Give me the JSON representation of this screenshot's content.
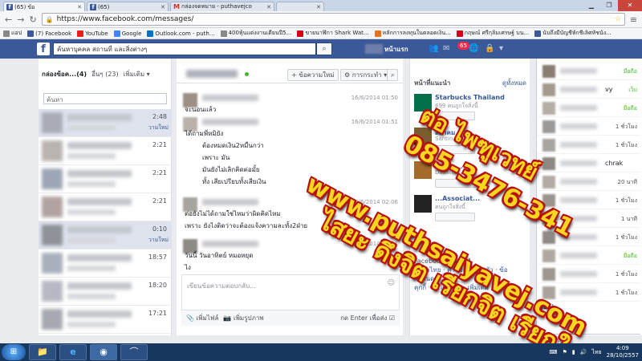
{
  "browser": {
    "tabs": [
      {
        "title": "(65)",
        "suffix": "ข้อ",
        "icon": "facebook-icon",
        "active": true
      },
      {
        "title": "(65)",
        "suffix": "",
        "icon": "facebook-icon",
        "active": false
      },
      {
        "title": "กล่องจดหมาย - puthavejco",
        "suffix": "",
        "icon": "gmail-icon",
        "active": false
      },
      {
        "title": "",
        "suffix": "",
        "icon": "blank-icon",
        "active": false
      }
    ],
    "url": "https://www.facebook.com/messages/",
    "bookmarks": [
      {
        "label": "แอป",
        "color": "#4a4a4a"
      },
      {
        "label": "(7) Facebook",
        "color": "#3b5998"
      },
      {
        "label": "YouTube",
        "color": "#e62117"
      },
      {
        "label": "Google",
        "color": "#4285f4"
      },
      {
        "label": "Outlook.com - puth...",
        "color": "#0072c6"
      },
      {
        "label": "400หุ้นแต่งงานเดียนปี5...",
        "color": "#888888"
      },
      {
        "label": "ขายนาฬิกา Shark Wat...",
        "color": "#d0021b"
      },
      {
        "label": "หลักการลงทุนในตลอดเงิน...",
        "color": "#e8711c"
      },
      {
        "label": "กฤษณ์ ศรีกุลิมเศรษฐ์ บน...",
        "color": "#d0021b"
      },
      {
        "label": "นับถึงมีบัญชีหักชีเลิศหัชนัง...",
        "color": "#3b5998"
      }
    ]
  },
  "fb": {
    "logo": "f",
    "search_placeholder": "ค้นหาบุคคล สถานที่ และสิ่งต่างๆ",
    "home": "หน้าแรก",
    "notification_count": "65",
    "accent": "#3b5998"
  },
  "inbox": {
    "tab_inbox": "กล่องข้อค...",
    "tab_inbox_count": "(4)",
    "tab_other": "อื่นๆ (23)",
    "more": "เพิ่มเติม",
    "search_placeholder": "ค้นหา",
    "conversations": [
      {
        "time": "2:48",
        "sub": "วามใหม่",
        "selected": true
      },
      {
        "time": "2:21",
        "sub": "",
        "selected": false
      },
      {
        "time": "2:21",
        "sub": "",
        "selected": false
      },
      {
        "time": "2:21",
        "sub": "",
        "selected": false
      },
      {
        "time": "0:10",
        "sub": "วามใหม่",
        "selected": true
      },
      {
        "time": "18:57",
        "sub": "",
        "selected": false
      },
      {
        "time": "18:20",
        "sub": "",
        "selected": false
      },
      {
        "time": "17:21",
        "sub": "",
        "selected": false
      }
    ]
  },
  "thread": {
    "new_message": "+ ข้อความใหม่",
    "actions": "การกระทำ",
    "messages": [
      {
        "time": "16/6/2014 01:50",
        "lines": [
          "จะนอนแล้ว"
        ]
      },
      {
        "time": "16/6/2014 01:51",
        "lines": [
          "ได้ถามพี่หมิยัง",
          "ต้องหมดเงิน2หมื่นกว่า",
          "เพราะ มัน",
          "มันยังไม่เลิกคิดต่อมั้ย",
          "ทั้ง เสียเปรียบทั้งเสียเงิน"
        ]
      },
      {
        "time": "16/6/2014 02:06",
        "lines": [
          "ต่อยังไม่ได้ถามใช่ไหมว่าผิดคิดไหม",
          "เพราะ ยังไงติดว่าจะต้องแจ้งความละทั้ง2ฝ่าย"
        ]
      },
      {
        "time": "16/6/2014 02:11",
        "lines": [
          "วันนี้ วันอาทิตย์ หมอหยุด",
          "ไง"
        ]
      }
    ],
    "composer_placeholder": "เขียนข้อความตอบกลับ...",
    "add_file": "เพิ่มไฟล์",
    "add_photo": "เพิ่มรูปภาพ",
    "enter_to_send": "กด Enter เพื่อส่ง"
  },
  "suggested": {
    "header": "หน้าที่แนะนำ",
    "see_all": "ดูทั้งหมด",
    "pages": [
      {
        "name": "Starbucks Thailand",
        "sub": "699 คนถูกใจสิ่งนี้",
        "color": "#00704a"
      },
      {
        "name": "สมาคม",
        "sub": "Santin...",
        "color": "#7a5c2e"
      },
      {
        "name": "สมาคม...",
        "sub": "Dinhin...",
        "color": "#a46a2b"
      },
      {
        "name": "...Associat...",
        "sub": "คนถูกใจสิ่งนี้",
        "color": "#222222"
      }
    ],
    "footer_copy": "Facebook © 2014",
    "footer_links": [
      "ภาษาไทย",
      "ความเป็นส่วนตัว",
      "ข้อกำหนด",
      "คุกกี้",
      "ลงโฆษณา",
      "เพิ่มเติม"
    ]
  },
  "chat": {
    "contacts": [
      {
        "status": "มือถือ",
        "online": true,
        "name": ""
      },
      {
        "status": "เว็บ",
        "online": true,
        "name": "vy"
      },
      {
        "status": "มือถือ",
        "online": true,
        "name": ""
      },
      {
        "status": "1 ชั่วโมง",
        "online": false,
        "name": ""
      },
      {
        "status": "1 ชั่วโมง",
        "online": false,
        "name": ""
      },
      {
        "status": "",
        "online": false,
        "name": "chrak"
      },
      {
        "status": "20 นาที",
        "online": false,
        "name": ""
      },
      {
        "status": "1 ชั่วโมง",
        "online": false,
        "name": ""
      },
      {
        "status": "1 นาที",
        "online": false,
        "name": ""
      },
      {
        "status": "1 ชั่วโมง",
        "online": false,
        "name": ""
      },
      {
        "status": "มือถือ",
        "online": true,
        "name": ""
      },
      {
        "status": "1 ชั่วโมง",
        "online": false,
        "name": ""
      },
      {
        "status": "1 ชั่วโมง",
        "online": false,
        "name": ""
      }
    ],
    "groups": "(24)",
    "search_placeholder": "ค้นหา"
  },
  "watermark": {
    "line1": "ต่อ ไพฑูเวทย์",
    "line2": "085-3476-341",
    "line3": "www.puthsaiyavej.com",
    "line4": "ไสยะ ดึงจิต เรียกจิต เรียกใจ"
  },
  "taskbar": {
    "time": "4:09",
    "date": "28/10/2557",
    "lang": "ไทย"
  }
}
